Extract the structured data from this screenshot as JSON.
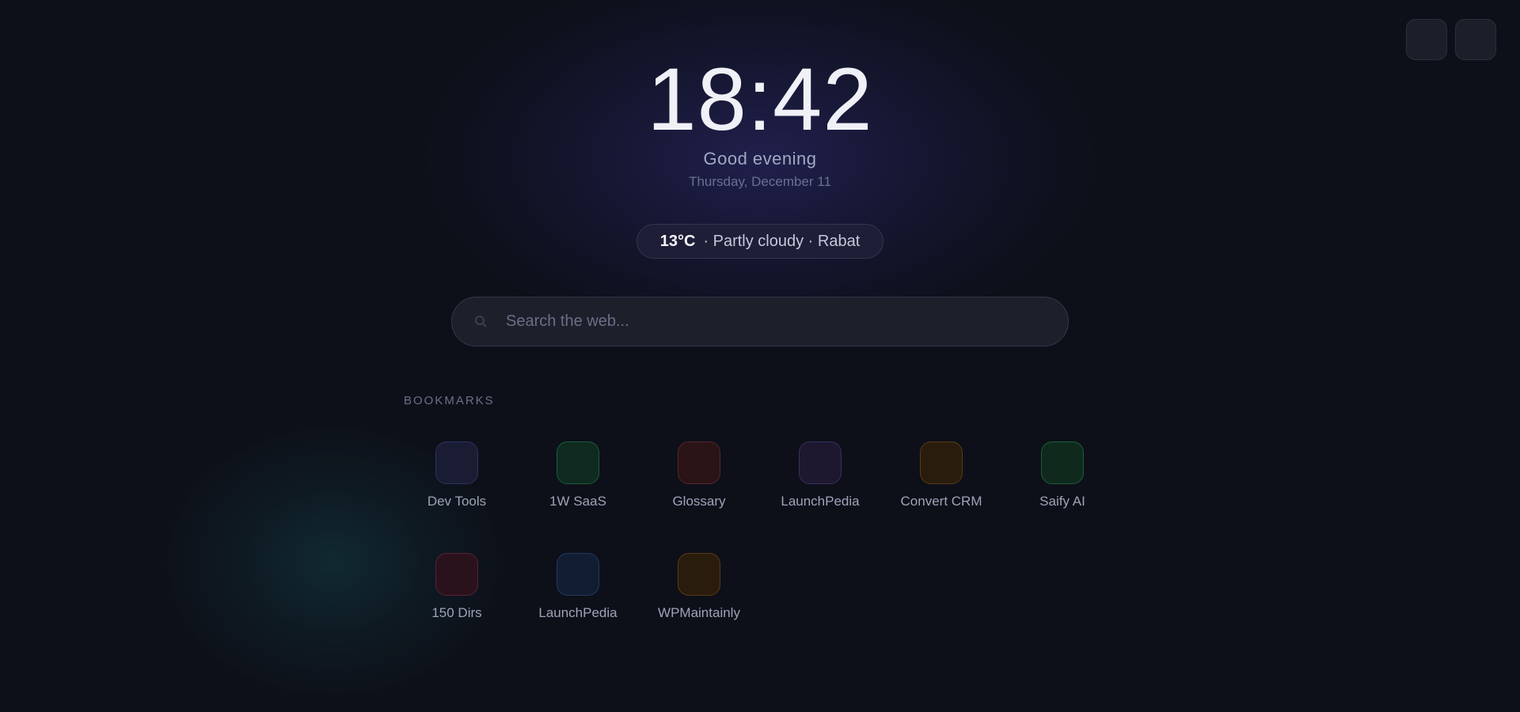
{
  "clock": {
    "time": "18:42"
  },
  "greeting": "Good evening",
  "date": "Thursday, December 11",
  "weather": {
    "temperature": "13°C",
    "condition": "· Partly cloudy · Rabat"
  },
  "search": {
    "placeholder": "Search the web..."
  },
  "bookmarks": {
    "heading": "BOOKMARKS",
    "items": [
      {
        "label": "Dev Tools",
        "bg": "#1a1c33",
        "border": "#2e3160"
      },
      {
        "label": "1W SaaS",
        "bg": "#0f2a20",
        "border": "#1f5a3c"
      },
      {
        "label": "Glossary",
        "bg": "#2a1416",
        "border": "#55262a"
      },
      {
        "label": "LaunchPedia",
        "bg": "#1d1830",
        "border": "#3a2e5c"
      },
      {
        "label": "Convert CRM",
        "bg": "#2a1c0d",
        "border": "#5a3a14"
      },
      {
        "label": "Saify AI",
        "bg": "#0f2a1d",
        "border": "#1f5a38"
      },
      {
        "label": "150 Dirs",
        "bg": "#2a121c",
        "border": "#5a2238"
      },
      {
        "label": "LaunchPedia",
        "bg": "#111e32",
        "border": "#22385e"
      },
      {
        "label": "WPMaintainly",
        "bg": "#2a1c0d",
        "border": "#5a3a14"
      }
    ]
  },
  "top_actions": [
    {
      "icon": "settings-icon"
    },
    {
      "icon": "menu-icon"
    }
  ]
}
